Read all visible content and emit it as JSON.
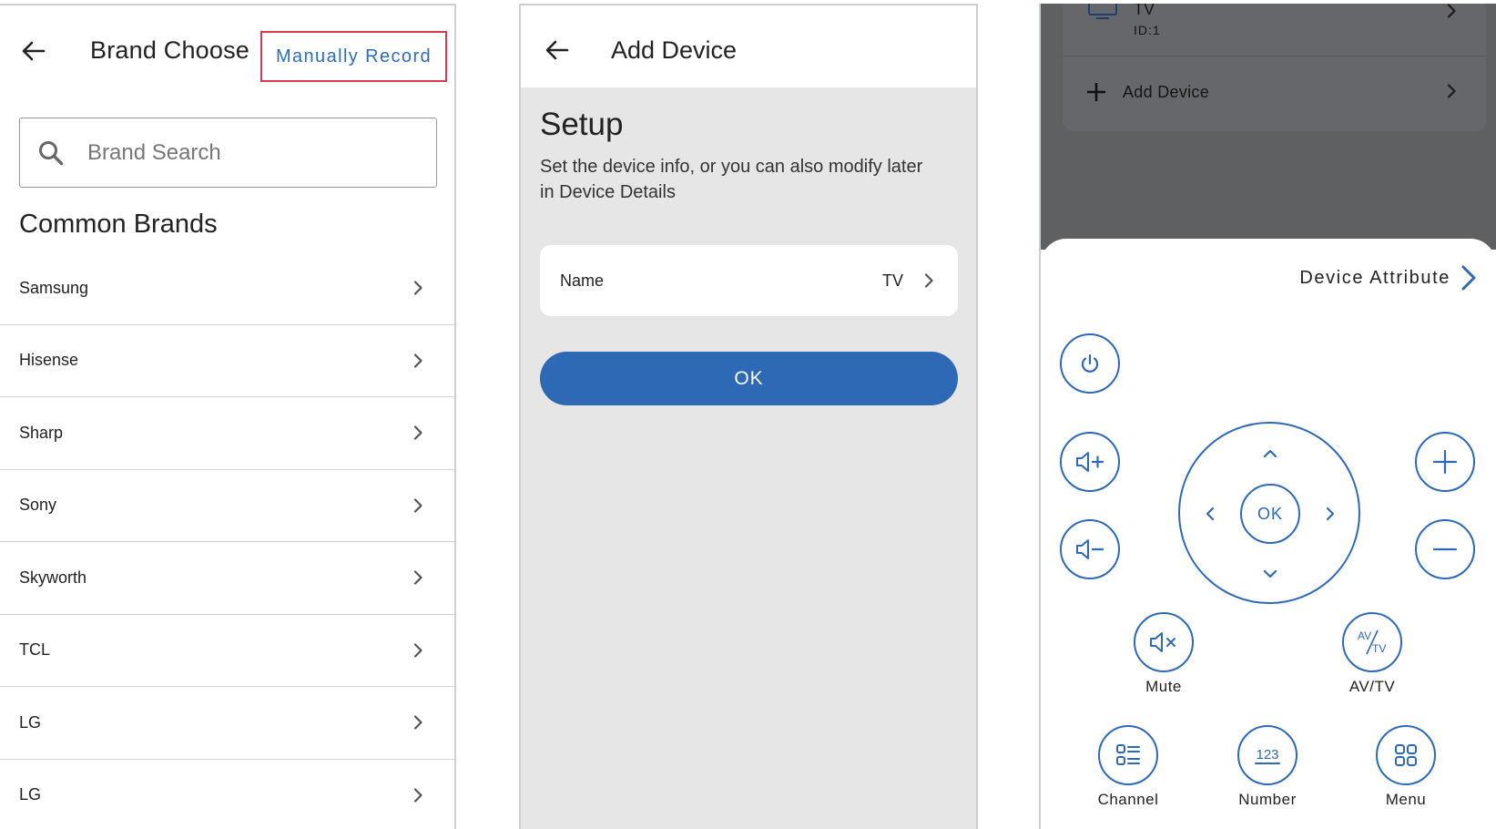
{
  "brand_choose": {
    "title": "Brand Choose",
    "manual_record": "Manually Record",
    "search_placeholder": "Brand Search",
    "common_title": "Common Brands",
    "brands": [
      "Samsung",
      "Hisense",
      "Sharp",
      "Sony",
      "Skyworth",
      "TCL",
      "LG",
      "LG"
    ]
  },
  "add_device": {
    "title": "Add Device",
    "setup_title": "Setup",
    "setup_desc": "Set the device info, or you can also modify later in Device Details",
    "name_label": "Name",
    "name_value": "TV",
    "ok_label": "OK"
  },
  "remote": {
    "background": {
      "device_name": "TV",
      "device_id": "ID:1",
      "add_device": "Add Device"
    },
    "device_attribute": "Device Attribute",
    "ok_label": "OK",
    "av_tv_top": "AV",
    "av_tv_bottom": "TV",
    "number_glyph": "123",
    "labels": {
      "mute": "Mute",
      "av_tv": "AV/TV",
      "channel": "Channel",
      "number": "Number",
      "menu": "Menu"
    }
  },
  "colors": {
    "accent": "#2e69b6",
    "highlight_border": "#d7374f",
    "link": "#2f6bbd",
    "panel_bg": "#e6e6e6",
    "dim_overlay": "#5f6062"
  }
}
